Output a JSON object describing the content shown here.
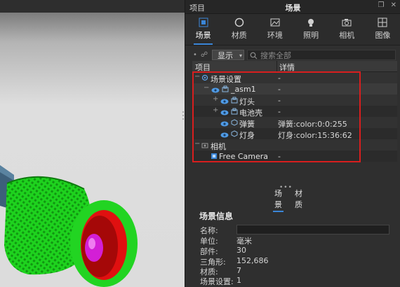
{
  "panel": {
    "left_title": "项目",
    "title": "场景",
    "controls": [
      "restore-icon",
      "close-icon"
    ]
  },
  "tabs": [
    {
      "label": "场景",
      "icon": "scene-icon",
      "active": true
    },
    {
      "label": "材质",
      "icon": "material-icon",
      "active": false
    },
    {
      "label": "环境",
      "icon": "environment-icon",
      "active": false
    },
    {
      "label": "照明",
      "icon": "lighting-icon",
      "active": false
    },
    {
      "label": "相机",
      "icon": "camera-icon",
      "active": false
    },
    {
      "label": "图像",
      "icon": "image-icon",
      "active": false
    }
  ],
  "toolbar": {
    "show_label": "显示",
    "search_placeholder": "搜索全部"
  },
  "tree": {
    "header_item": "项目",
    "header_detail": "详情",
    "rows": [
      {
        "name": "场景设置",
        "detail": "-"
      },
      {
        "name": "_asm1",
        "detail": "-"
      },
      {
        "name": "灯头",
        "detail": "-"
      },
      {
        "name": "电池壳",
        "detail": "-"
      },
      {
        "name": "弹簧",
        "detail": "弹簧:color:0:0:255"
      },
      {
        "name": "灯身",
        "detail": "灯身:color:15:36:62"
      },
      {
        "name": "相机",
        "detail": ""
      },
      {
        "name": "Free Camera",
        "detail": "-"
      }
    ]
  },
  "subtabs": [
    {
      "label": "场景",
      "active": true
    },
    {
      "label": "材质",
      "active": false
    }
  ],
  "scene_info": {
    "title": "场景信息",
    "name_label": "名称:",
    "name_value": "",
    "unit_label": "单位:",
    "unit_value": "毫米",
    "parts_label": "部件:",
    "parts_value": "30",
    "tris_label": "三角形:",
    "tris_value": "152,686",
    "materials_label": "材质:",
    "materials_value": "7",
    "settings_label": "场景设置:",
    "settings_value": "1"
  },
  "colors": {
    "accent": "#3b86d8",
    "highlight_box": "#d81e1e",
    "model_green": "#22d422",
    "model_red": "#e01010",
    "model_magenta": "#d31fd6",
    "model_steel": "#3d5f7a"
  }
}
